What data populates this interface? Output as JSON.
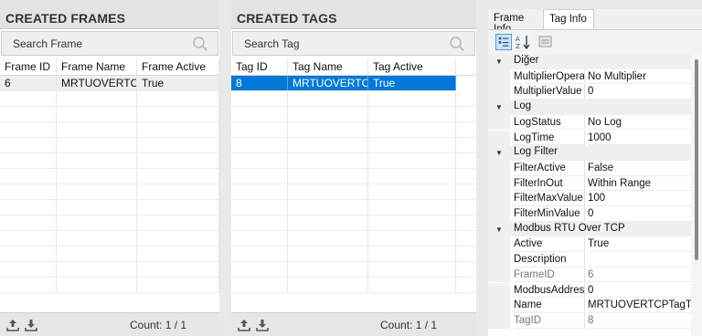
{
  "frames_panel": {
    "title": "CREATED FRAMES",
    "search_placeholder": "Search Frame",
    "columns": [
      "Frame ID",
      "Frame Name",
      "Frame Active"
    ],
    "rows": [
      [
        "6",
        "MRTUOVERTC...",
        "True"
      ]
    ],
    "count": "Count: 1 / 1"
  },
  "tags_panel": {
    "title": "CREATED TAGS",
    "search_placeholder": "Search Tag",
    "columns": [
      "Tag ID",
      "Tag Name",
      "Tag Active"
    ],
    "rows": [
      [
        "8",
        "MRTUOVERTC...",
        "True"
      ]
    ],
    "count": "Count: 1 / 1"
  },
  "props_panel": {
    "tabs": [
      "Frame Info",
      "Tag Info"
    ],
    "active_tab": "Tag Info",
    "categories": [
      {
        "name": "Diğer",
        "props": [
          {
            "name": "MultiplierOperat",
            "value": "No Multiplier"
          },
          {
            "name": "MultiplierValue",
            "value": "0"
          }
        ]
      },
      {
        "name": "Log",
        "props": [
          {
            "name": "LogStatus",
            "value": "No Log"
          },
          {
            "name": "LogTime",
            "value": "1000"
          }
        ]
      },
      {
        "name": "Log Filter",
        "props": [
          {
            "name": "FilterActive",
            "value": "False"
          },
          {
            "name": "FilterInOut",
            "value": "Within Range"
          },
          {
            "name": "FilterMaxValue",
            "value": "100"
          },
          {
            "name": "FilterMinValue",
            "value": "0"
          }
        ]
      },
      {
        "name": "Modbus RTU Over TCP",
        "props": [
          {
            "name": "Active",
            "value": "True"
          },
          {
            "name": "Description",
            "value": ""
          },
          {
            "name": "FrameID",
            "value": "6",
            "readonly": true
          },
          {
            "name": "ModbusAddress",
            "value": "0"
          },
          {
            "name": "Name",
            "value": "MRTUOVERTCPTagTe"
          },
          {
            "name": "TagID",
            "value": "8",
            "readonly": true
          }
        ]
      }
    ]
  },
  "colors": {
    "selection_blue": "#0078d7",
    "header_gray": "#e3e3e3"
  }
}
